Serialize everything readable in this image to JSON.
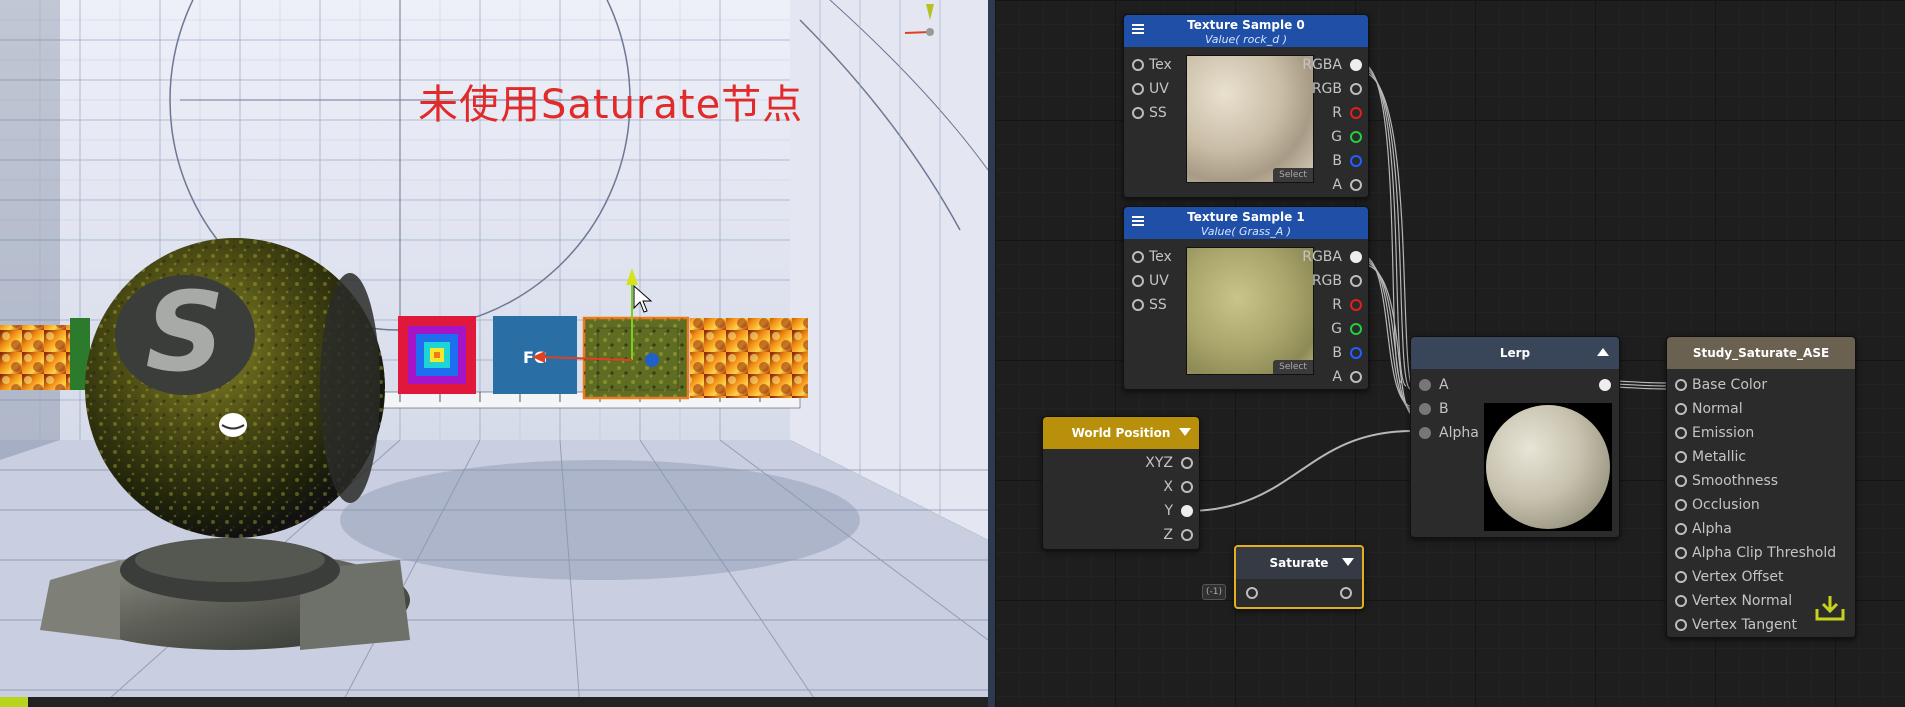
{
  "viewport": {
    "caption": "未使用Saturate节点",
    "cube_label": "FG"
  },
  "graph": {
    "nodes": {
      "tex0": {
        "title": "Texture Sample 0",
        "subtitle": "Value( rock_d )",
        "inputs": [
          "Tex",
          "UV",
          "SS"
        ],
        "outputs": [
          "RGBA",
          "RGB",
          "R",
          "G",
          "B",
          "A"
        ],
        "select_label": "Select"
      },
      "tex1": {
        "title": "Texture Sample 1",
        "subtitle": "Value( Grass_A )",
        "inputs": [
          "Tex",
          "UV",
          "SS"
        ],
        "outputs": [
          "RGBA",
          "RGB",
          "R",
          "G",
          "B",
          "A"
        ],
        "select_label": "Select"
      },
      "lerp": {
        "title": "Lerp",
        "inputs": [
          "A",
          "B",
          "Alpha"
        ]
      },
      "worldpos": {
        "title": "World Position",
        "outputs": [
          "XYZ",
          "X",
          "Y",
          "Z"
        ]
      },
      "saturate": {
        "title": "Saturate",
        "input_chip": "(-1)"
      },
      "output": {
        "title": "Study_Saturate_ASE",
        "inputs": [
          "Base Color",
          "Normal",
          "Emission",
          "Metallic",
          "Smoothness",
          "Occlusion",
          "Alpha",
          "Alpha Clip Threshold",
          "Vertex Offset",
          "Vertex Normal",
          "Vertex Tangent"
        ]
      }
    }
  },
  "colors": {
    "texture_header": "#1f4fa6",
    "lerp_header": "#39465a",
    "worldpos_header": "#b8900c",
    "saturate_border": "#e0b020",
    "output_header": "#6b6150",
    "caption": "#e12a2a"
  },
  "icons": {
    "node_menu": "hamburger-icon",
    "collapse": "triangle-down-icon",
    "expand": "triangle-up-icon",
    "save_output": "download-tray-icon"
  }
}
